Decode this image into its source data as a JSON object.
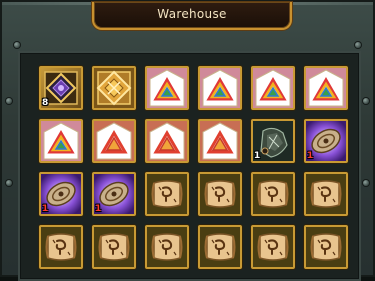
{
  "window": {
    "title": "Warehouse"
  },
  "slots": [
    {
      "item": "dark-rune-crystal",
      "qty": "8",
      "qty_color": "white"
    },
    {
      "item": "gold-rune-crystal",
      "qty": "",
      "qty_color": "white"
    },
    {
      "item": "rainbow-triangle-scroll",
      "qty": "",
      "qty_color": "white"
    },
    {
      "item": "rainbow-triangle-scroll",
      "qty": "",
      "qty_color": "white"
    },
    {
      "item": "rainbow-triangle-scroll",
      "qty": "",
      "qty_color": "white"
    },
    {
      "item": "rainbow-triangle-scroll",
      "qty": "",
      "qty_color": "white"
    },
    {
      "item": "rainbow-triangle-scroll",
      "qty": "",
      "qty_color": "white"
    },
    {
      "item": "red-triangle-scroll",
      "qty": "",
      "qty_color": "white"
    },
    {
      "item": "red-triangle-scroll",
      "qty": "",
      "qty_color": "white"
    },
    {
      "item": "red-triangle-scroll",
      "qty": "",
      "qty_color": "white"
    },
    {
      "item": "dark-gauntlet",
      "qty": "1",
      "qty_color": "white"
    },
    {
      "item": "spirit-disc",
      "qty": "1",
      "qty_color": "red"
    },
    {
      "item": "spirit-disc",
      "qty": "1",
      "qty_color": "red"
    },
    {
      "item": "spirit-disc",
      "qty": "1",
      "qty_color": "red"
    },
    {
      "item": "rune-parchment",
      "qty": "",
      "qty_color": "white"
    },
    {
      "item": "rune-parchment",
      "qty": "",
      "qty_color": "white"
    },
    {
      "item": "rune-parchment",
      "qty": "",
      "qty_color": "white"
    },
    {
      "item": "rune-parchment",
      "qty": "",
      "qty_color": "white"
    },
    {
      "item": "rune-parchment",
      "qty": "",
      "qty_color": "white"
    },
    {
      "item": "rune-parchment",
      "qty": "",
      "qty_color": "white"
    },
    {
      "item": "rune-parchment",
      "qty": "",
      "qty_color": "white"
    },
    {
      "item": "rune-parchment",
      "qty": "",
      "qty_color": "white"
    },
    {
      "item": "rune-parchment",
      "qty": "",
      "qty_color": "white"
    },
    {
      "item": "rune-parchment",
      "qty": "",
      "qty_color": "white"
    }
  ],
  "colors": {
    "slot_border": "#c89a34",
    "title_text": "#f3e4c2",
    "panel_bg": "#1b2220"
  }
}
